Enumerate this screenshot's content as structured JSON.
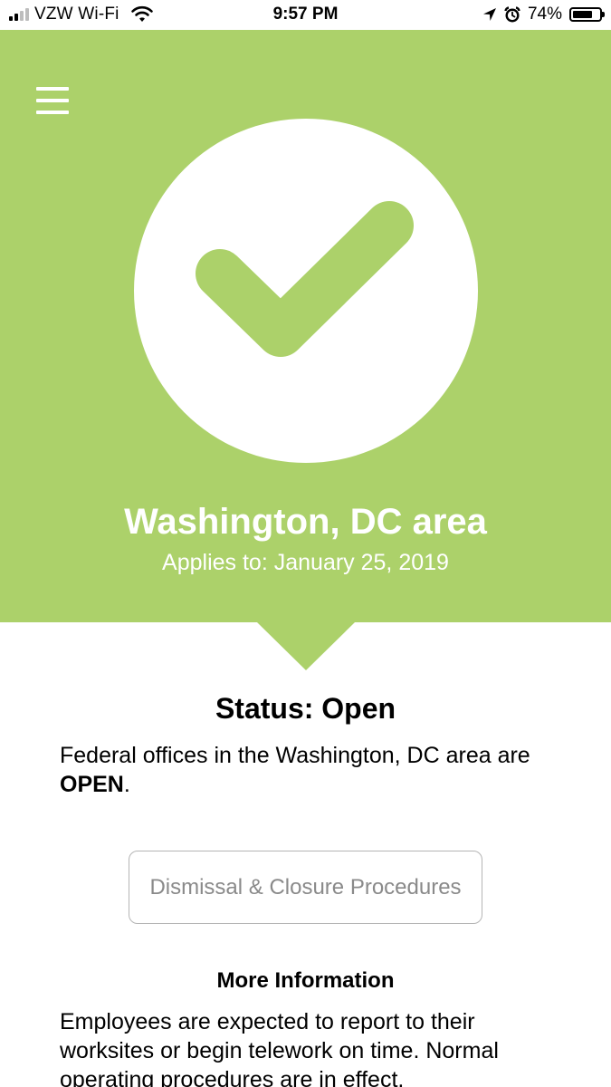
{
  "status_bar": {
    "carrier": "VZW Wi-Fi",
    "time": "9:57 PM",
    "battery": "74%",
    "battery_level": 0.74,
    "icons": [
      "signal-icon",
      "wifi-icon",
      "location-arrow-icon",
      "alarm-icon",
      "battery-icon"
    ]
  },
  "header": {
    "menu_icon": "menu-icon",
    "status_icon": "checkmark-icon",
    "region": "Washington, DC area",
    "applies_to": "Applies to: January 25, 2019"
  },
  "status": {
    "heading": "Status: Open",
    "message_prefix": "Federal offices in the Washington, DC area are ",
    "message_bold": "OPEN",
    "message_suffix": "."
  },
  "procedures_button": {
    "label": "Dismissal & Closure Procedures"
  },
  "more_info": {
    "heading": "More Information",
    "text": "Employees are expected to report to their worksites or begin telework on time. Normal operating procedures are in effect."
  },
  "colors": {
    "accent_green": "#acd16a",
    "button_border": "#b5b5b5",
    "button_text": "#8a8a8a"
  }
}
